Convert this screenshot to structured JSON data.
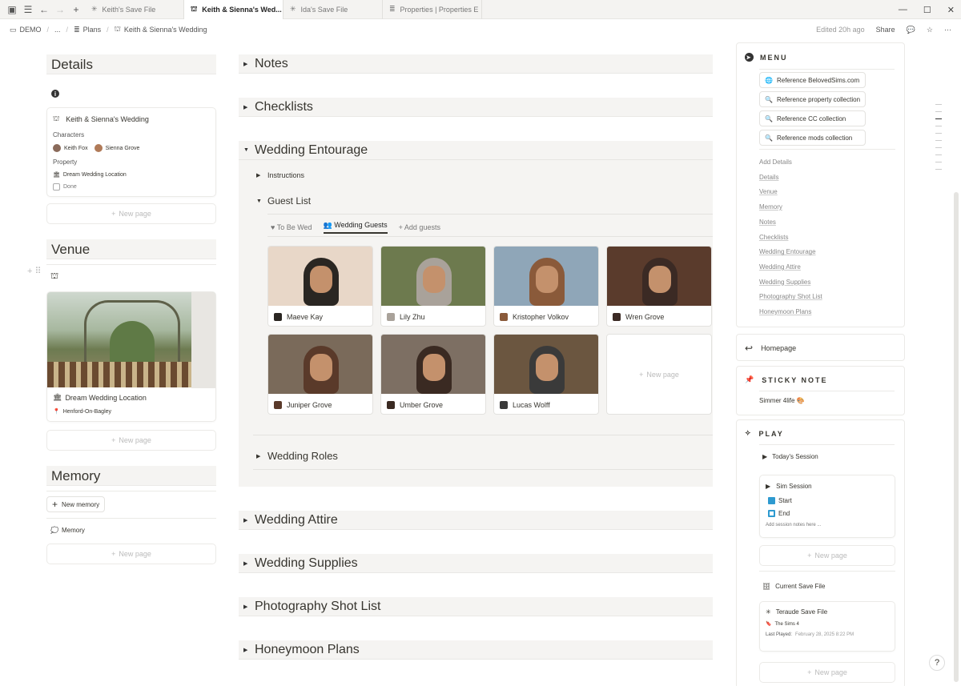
{
  "tabs": [
    {
      "label": "Keith's Save File",
      "icon": "asterisk-icon"
    },
    {
      "label": "Keith & Sienna's Wed...",
      "icon": "gazebo-icon"
    },
    {
      "label": "Ida's Save File",
      "icon": "asterisk-icon"
    },
    {
      "label": "Properties | Properties E",
      "icon": "stack-icon"
    }
  ],
  "breadcrumb": {
    "workspace": "DEMO",
    "ellipsis": "...",
    "plans": "Plans",
    "page": "Keith & Sienna's Wedding"
  },
  "topbar": {
    "edited": "Edited 20h ago",
    "share": "Share"
  },
  "details": {
    "title": "Details",
    "card_title": "Keith & Sienna's Wedding",
    "characters_label": "Characters",
    "characters": [
      "Keith Fox",
      "Sienna Grove"
    ],
    "property_label": "Property",
    "property_value": "Dream Wedding Location",
    "done_label": "Done",
    "new_page": "New page"
  },
  "venue": {
    "title": "Venue",
    "location": "Dream Wedding Location",
    "town": "Henford-On-Bagley",
    "new_page": "New page"
  },
  "memory": {
    "title": "Memory",
    "new_button": "New memory",
    "item": "Memory",
    "new_page": "New page"
  },
  "center": {
    "notes": "Notes",
    "checklists": "Checklists",
    "entourage": "Wedding Entourage",
    "instructions": "Instructions",
    "guest_list": "Guest List",
    "guest_tabs": [
      "To Be Wed",
      "Wedding Guests",
      "Add guests"
    ],
    "guests": [
      {
        "name": "Maeve Kay",
        "bg": "#e8d7c8",
        "fg": "#2a2622"
      },
      {
        "name": "Lily Zhu",
        "bg": "#6d7a4e",
        "fg": "#a9a29a"
      },
      {
        "name": "Kristopher Volkov",
        "bg": "#8fa6b8",
        "fg": "#8a5a3a"
      },
      {
        "name": "Wren Grove",
        "bg": "#5a3b2c",
        "fg": "#3b2a24"
      },
      {
        "name": "Juniper Grove",
        "bg": "#7a6a5a",
        "fg": "#5a3a2a"
      },
      {
        "name": "Umber Grove",
        "bg": "#7d6f63",
        "fg": "#3a2a22"
      },
      {
        "name": "Lucas Wolff",
        "bg": "#6b5640",
        "fg": "#3a3a3a"
      }
    ],
    "guest_new_page": "New page",
    "roles": "Wedding Roles",
    "attire": "Wedding Attire",
    "supplies": "Wedding Supplies",
    "photo": "Photography Shot List",
    "honeymoon": "Honeymoon Plans"
  },
  "menu": {
    "title": "MENU",
    "refs": [
      "Reference BelovedSims.com",
      "Reference property collection",
      "Reference CC collection",
      "Reference mods collection"
    ],
    "links": [
      "Add Details",
      "Details",
      "Venue",
      "Memory",
      "Notes",
      "Checklists",
      "Wedding Entourage",
      "Wedding Attire",
      "Wedding Supplies",
      "Photography Shot List",
      "Honeymoon Plans"
    ]
  },
  "homepage": "Homepage",
  "sticky": {
    "title": "STICKY NOTE",
    "text": "Simmer 4life"
  },
  "play": {
    "title": "PLAY",
    "today": "Today's Session",
    "session_title": "Sim Session",
    "start": "Start",
    "end": "End",
    "notes_ph": "Add session notes here ...",
    "new_page": "New page",
    "current": "Current Save File",
    "save_title": "Teraude Save File",
    "game": "The Sims 4",
    "last_played_label": "Last Played:",
    "last_played": "February 28, 2025 8:22 PM",
    "new_page2": "New page"
  }
}
